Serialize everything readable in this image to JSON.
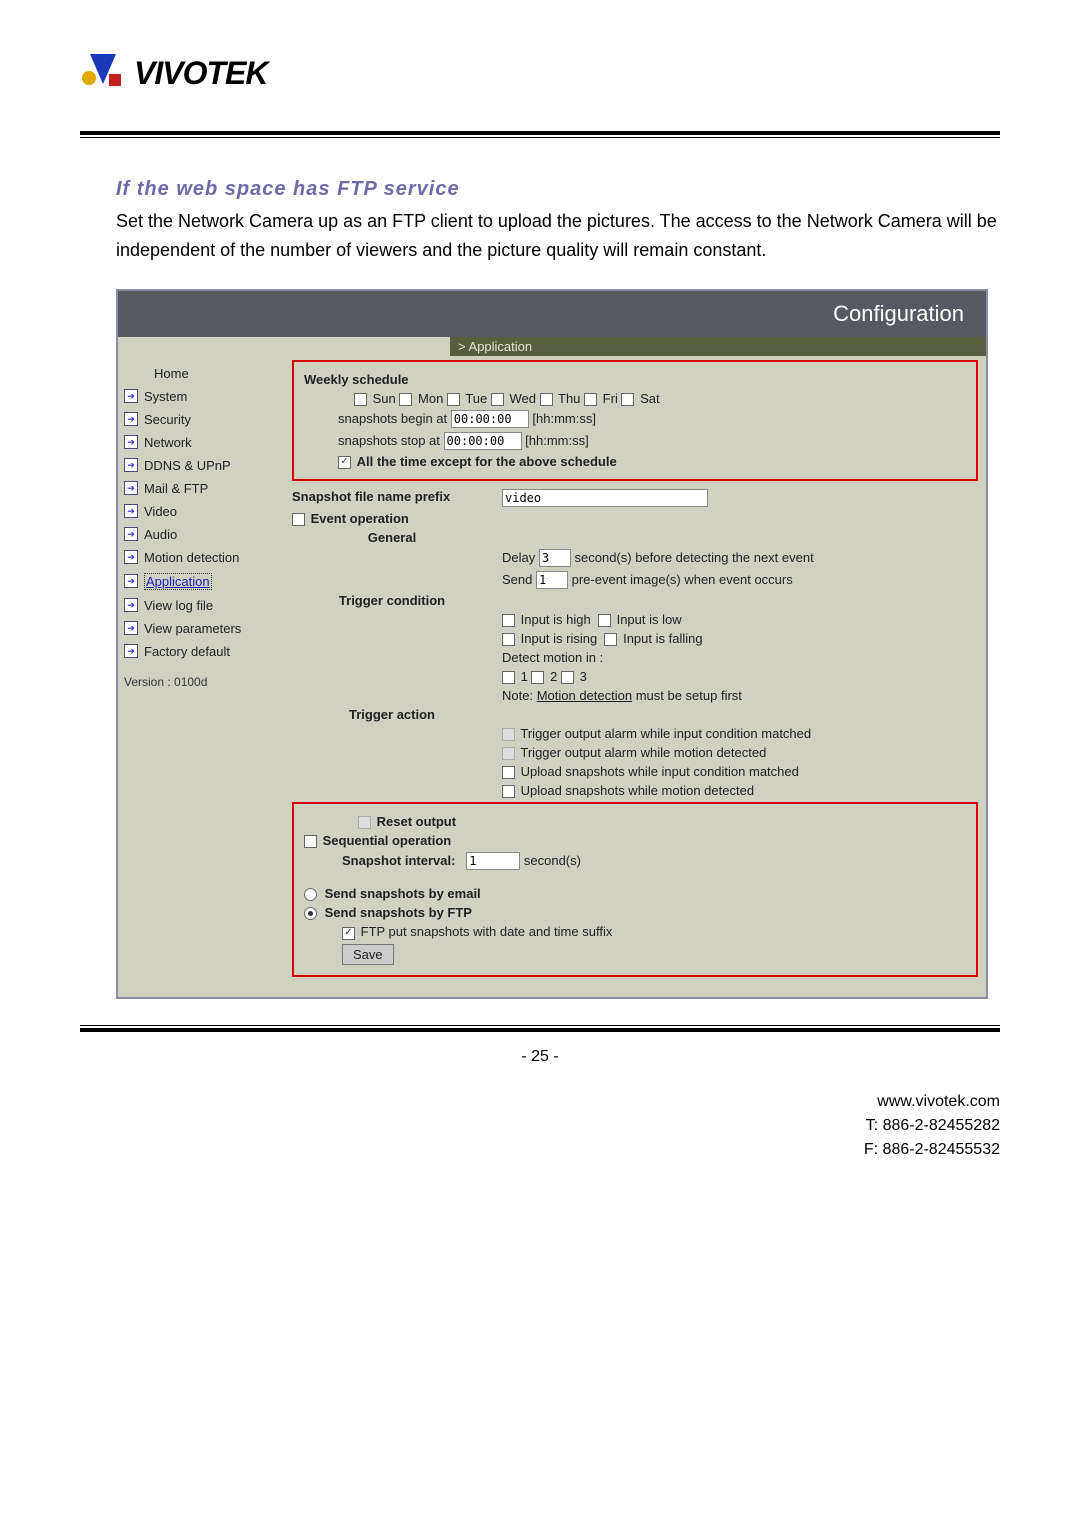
{
  "logo_text": "VIVOTEK",
  "section_heading": "If the web space has FTP service",
  "body_text": "Set the Network Camera up as an FTP client to upload the pictures. The access to the Network Camera will be independent of the number of viewers and the picture quality will remain constant.",
  "config": {
    "title": "Configuration",
    "breadcrumb": "> Application",
    "sidebar": {
      "items": [
        {
          "label": "Home",
          "has_arrow": false
        },
        {
          "label": "System",
          "has_arrow": true
        },
        {
          "label": "Security",
          "has_arrow": true
        },
        {
          "label": "Network",
          "has_arrow": true
        },
        {
          "label": "DDNS & UPnP",
          "has_arrow": true
        },
        {
          "label": "Mail & FTP",
          "has_arrow": true
        },
        {
          "label": "Video",
          "has_arrow": true
        },
        {
          "label": "Audio",
          "has_arrow": true
        },
        {
          "label": "Motion detection",
          "has_arrow": true
        },
        {
          "label": "Application",
          "has_arrow": true,
          "active": true
        },
        {
          "label": "View log file",
          "has_arrow": true
        },
        {
          "label": "View parameters",
          "has_arrow": true
        },
        {
          "label": "Factory default",
          "has_arrow": true
        }
      ],
      "version": "Version : 0100d"
    },
    "weekly": {
      "title": "Weekly schedule",
      "days": [
        "Sun",
        "Mon",
        "Tue",
        "Wed",
        "Thu",
        "Fri",
        "Sat"
      ],
      "begin_label_pre": "snapshots begin at",
      "begin_value": "00:00:00",
      "begin_label_post": "[hh:mm:ss]",
      "stop_label_pre": "snapshots stop at",
      "stop_value": "00:00:00",
      "stop_label_post": "[hh:mm:ss]",
      "except_label": "All the time except for the above schedule"
    },
    "snapshot_prefix_label": "Snapshot file name prefix",
    "snapshot_prefix_value": "video",
    "event_operation_label": "Event operation",
    "general_label": "General",
    "delay_pre": "Delay",
    "delay_value": "3",
    "delay_post": "second(s) before detecting the next event",
    "send_pre": "Send",
    "send_value": "1",
    "send_post": "pre-event image(s) when event occurs",
    "trigger_condition_label": "Trigger condition",
    "tc_input_high": "Input is high",
    "tc_input_low": "Input is low",
    "tc_input_rising": "Input is rising",
    "tc_input_falling": "Input is falling",
    "detect_motion_label": "Detect motion in :",
    "dm_options": [
      "1",
      "2",
      "3"
    ],
    "note_pre": "Note: ",
    "note_link": "Motion detection",
    "note_post": " must be setup first",
    "trigger_action_label": "Trigger action",
    "ta_out_match": "Trigger output alarm while input condition matched",
    "ta_out_motion": "Trigger output alarm while motion detected",
    "ta_up_match": "Upload snapshots while input condition matched",
    "ta_up_motion": "Upload snapshots while motion detected",
    "reset_output": "Reset output",
    "sequential_label": "Sequential operation",
    "interval_label": "Snapshot interval:",
    "interval_value": "1",
    "interval_unit": "second(s)",
    "send_email": "Send snapshots by email",
    "send_ftp": "Send snapshots by FTP",
    "ftp_suffix": "FTP put snapshots with date and time suffix",
    "save_btn": "Save"
  },
  "page_number": "- 25 -",
  "footer": {
    "url": "www.vivotek.com",
    "tel": "T: 886-2-82455282",
    "fax": "F: 886-2-82455532"
  }
}
